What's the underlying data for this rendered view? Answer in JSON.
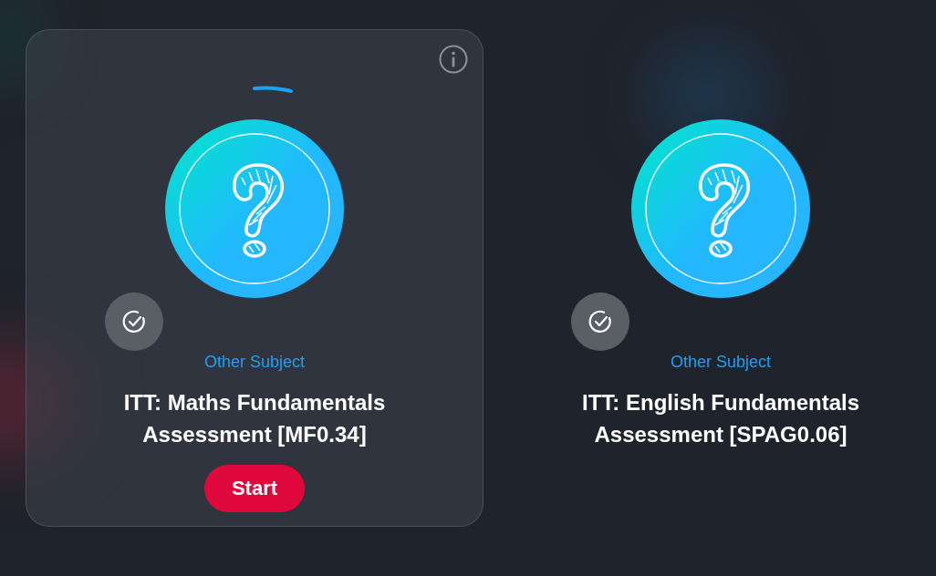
{
  "cards": [
    {
      "selected": true,
      "subject": "Other Subject",
      "title": "ITT: Maths Fundamentals Assessment [MF0.34]",
      "button": "Start"
    },
    {
      "selected": false,
      "subject": "Other Subject",
      "title": "ITT: English Fundamentals Assessment [SPAG0.06]"
    }
  ]
}
